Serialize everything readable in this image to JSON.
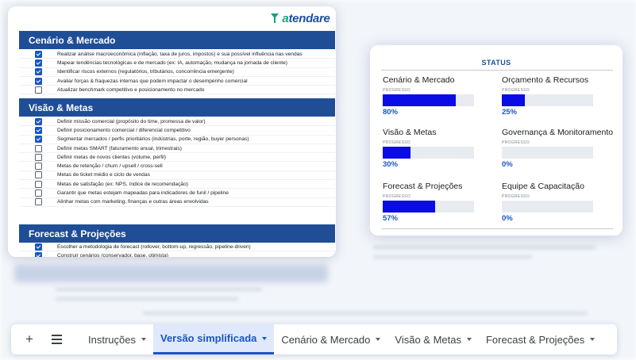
{
  "brand": {
    "name_prefix": "a",
    "name_rest": "tendare"
  },
  "checklist": {
    "sections": [
      {
        "title": "Cenário & Mercado",
        "tasks": [
          {
            "text": "Realizar análise macroeconômica (inflação, taxa de juros, impostos) e sua possível influência nas vendas",
            "checked": true
          },
          {
            "text": "Mapear tendências tecnológicas e de mercado (ex: IA, automação, mudança na jornada de cliente)",
            "checked": true
          },
          {
            "text": "Identificar riscos externos (regulatórios, tributários, concorrência emergente)",
            "checked": true
          },
          {
            "text": "Avaliar forças & fraquezas internas que podem impactar o desempenho comercial",
            "checked": true
          },
          {
            "text": "Atualizar benchmark competitivo e posicionamento no mercado",
            "checked": false
          }
        ]
      },
      {
        "title": "Visão & Metas",
        "tasks": [
          {
            "text": "Definir missão comercial (propósito do time, promessa de valor)",
            "checked": true
          },
          {
            "text": "Definir posicionamento comercial / diferencial competitivo",
            "checked": true
          },
          {
            "text": "Segmentar mercados / perfis prioritários (indústrias, porte, região, buyer personas)",
            "checked": true
          },
          {
            "text": "Definir metas SMART (faturamento anual, trimestrais)",
            "checked": false
          },
          {
            "text": "Definir metas de novos clientes (volume, perfil)",
            "checked": false
          },
          {
            "text": "Metas de retenção / churn / upsell / cross-sell",
            "checked": false
          },
          {
            "text": "Metas de ticket médio e ciclo de vendas",
            "checked": false
          },
          {
            "text": "Metas de satisfação (ex: NPS, índice de recomendação)",
            "checked": false
          },
          {
            "text": "Garantir que metas estejam mapeadas para indicadores de funil / pipeline",
            "checked": false
          },
          {
            "text": "Alinhar metas com marketing, finanças e outras áreas envolvidas",
            "checked": false
          }
        ]
      },
      {
        "title": "Forecast & Projeções",
        "tasks": [
          {
            "text": "Escolher a metodologia de forecast (rollover, bottom-up, regressão, pipeline-driven)",
            "checked": true
          },
          {
            "text": "Construir cenários (conservador, base, otimista)",
            "checked": true
          }
        ]
      }
    ]
  },
  "status": {
    "title": "STATUS",
    "progress_label": "PROGRESSO",
    "metrics": [
      {
        "title": "Cenário & Mercado",
        "pct_label": "80%",
        "value": 0.8
      },
      {
        "title": "Orçamento & Recursos",
        "pct_label": "25%",
        "value": 0.25
      },
      {
        "title": "Visão & Metas",
        "pct_label": "30%",
        "value": 0.3
      },
      {
        "title": "Governança & Monitoramento",
        "pct_label": "0%",
        "value": 0.0
      },
      {
        "title": "Forecast & Projeções",
        "pct_label": "57%",
        "value": 0.57
      },
      {
        "title": "Equipe & Capacitação",
        "pct_label": "0%",
        "value": 0.0
      }
    ]
  },
  "tabs": {
    "add_label": "+",
    "items": [
      {
        "label": "Instruções",
        "active": false
      },
      {
        "label": "Versão simplificada",
        "active": true
      },
      {
        "label": "Cenário & Mercado",
        "active": false
      },
      {
        "label": "Visão & Metas",
        "active": false
      },
      {
        "label": "Forecast & Projeções",
        "active": false
      }
    ]
  },
  "colors": {
    "section_header": "#1f4e96",
    "progress_fill": "#0a0be6",
    "accent": "#1a56c4",
    "brand_green": "#16a37d"
  }
}
